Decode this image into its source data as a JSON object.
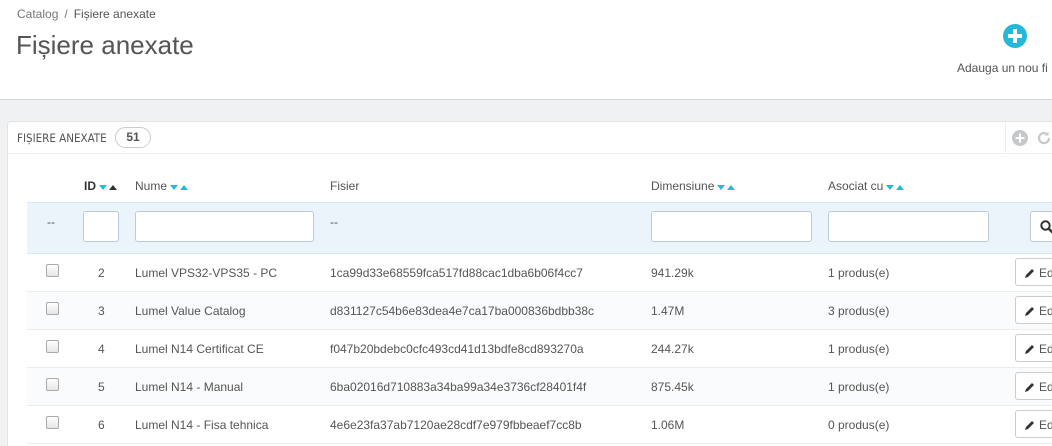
{
  "breadcrumb": {
    "parent": "Catalog",
    "separator": "/",
    "current": "Fișiere anexate"
  },
  "page": {
    "title": "Fișiere anexate"
  },
  "toolbar": {
    "add_label": "Adauga un nou fi"
  },
  "panel": {
    "title": "FIȘIERE ANEXATE",
    "count": "51"
  },
  "columns": {
    "id": "ID",
    "name": "Nume",
    "file": "Fisier",
    "size": "Dimensiune",
    "associated": "Asociat cu"
  },
  "filters": {
    "select_dash": "--",
    "file_dash": "--"
  },
  "rows": [
    {
      "id": "2",
      "name": "Lumel VPS32-VPS35 - PC",
      "file": "1ca99d33e68559fca517fd88cac1dba6b06f4cc7",
      "size": "941.29k",
      "associated": "1 produs(e)",
      "action": "Ed"
    },
    {
      "id": "3",
      "name": "Lumel Value Catalog",
      "file": "d831127c54b6e83dea4e7ca17ba000836bdbb38c",
      "size": "1.47M",
      "associated": "3 produs(e)",
      "action": "Ed"
    },
    {
      "id": "4",
      "name": "Lumel N14 Certificat CE",
      "file": "f047b20bdebc0cfc493cd41d13bdfe8cd893270a",
      "size": "244.27k",
      "associated": "1 produs(e)",
      "action": "Ed"
    },
    {
      "id": "5",
      "name": "Lumel N14 - Manual",
      "file": "6ba02016d710883a34ba99a34e3736cf28401f4f",
      "size": "875.45k",
      "associated": "1 produs(e)",
      "action": "Ed"
    },
    {
      "id": "6",
      "name": "Lumel N14 - Fisa tehnica",
      "file": "4e6e23fa37ab7120ae28cdf7e979fbbeaef7cc8b",
      "size": "1.06M",
      "associated": "0 produs(e)",
      "action": "Ed"
    }
  ],
  "colors": {
    "accent": "#25b9d7"
  }
}
